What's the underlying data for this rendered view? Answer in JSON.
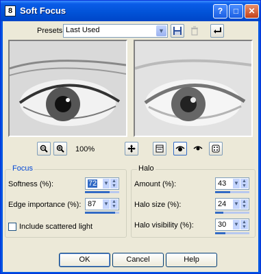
{
  "window": {
    "title": "Soft Focus",
    "app_icon_glyph": "8"
  },
  "titlebar_buttons": {
    "help": "?",
    "maximize": "□",
    "close": "✕"
  },
  "presets": {
    "label": "Presets:",
    "value": "Last Used"
  },
  "preview": {
    "zoom_level": "100%"
  },
  "focus": {
    "title": "Focus",
    "softness": {
      "label": "Softness (%):",
      "value": "72",
      "level": 72
    },
    "edge": {
      "label": "Edge importance (%):",
      "value": "87",
      "level": 87
    },
    "scattered": {
      "label": "Include scattered light",
      "checked": false
    }
  },
  "halo": {
    "title": "Halo",
    "amount": {
      "label": "Amount (%):",
      "value": "43",
      "level": 43
    },
    "size": {
      "label": "Halo size (%):",
      "value": "24",
      "level": 24
    },
    "visibility": {
      "label": "Halo visibility (%):",
      "value": "30",
      "level": 30
    }
  },
  "buttons": {
    "ok": "OK",
    "cancel": "Cancel",
    "help": "Help"
  },
  "colors": {
    "titlebar": "#0054e3",
    "dialog_bg": "#ece9d8",
    "selection": "#316ac5",
    "group_title": "#0046d5"
  }
}
